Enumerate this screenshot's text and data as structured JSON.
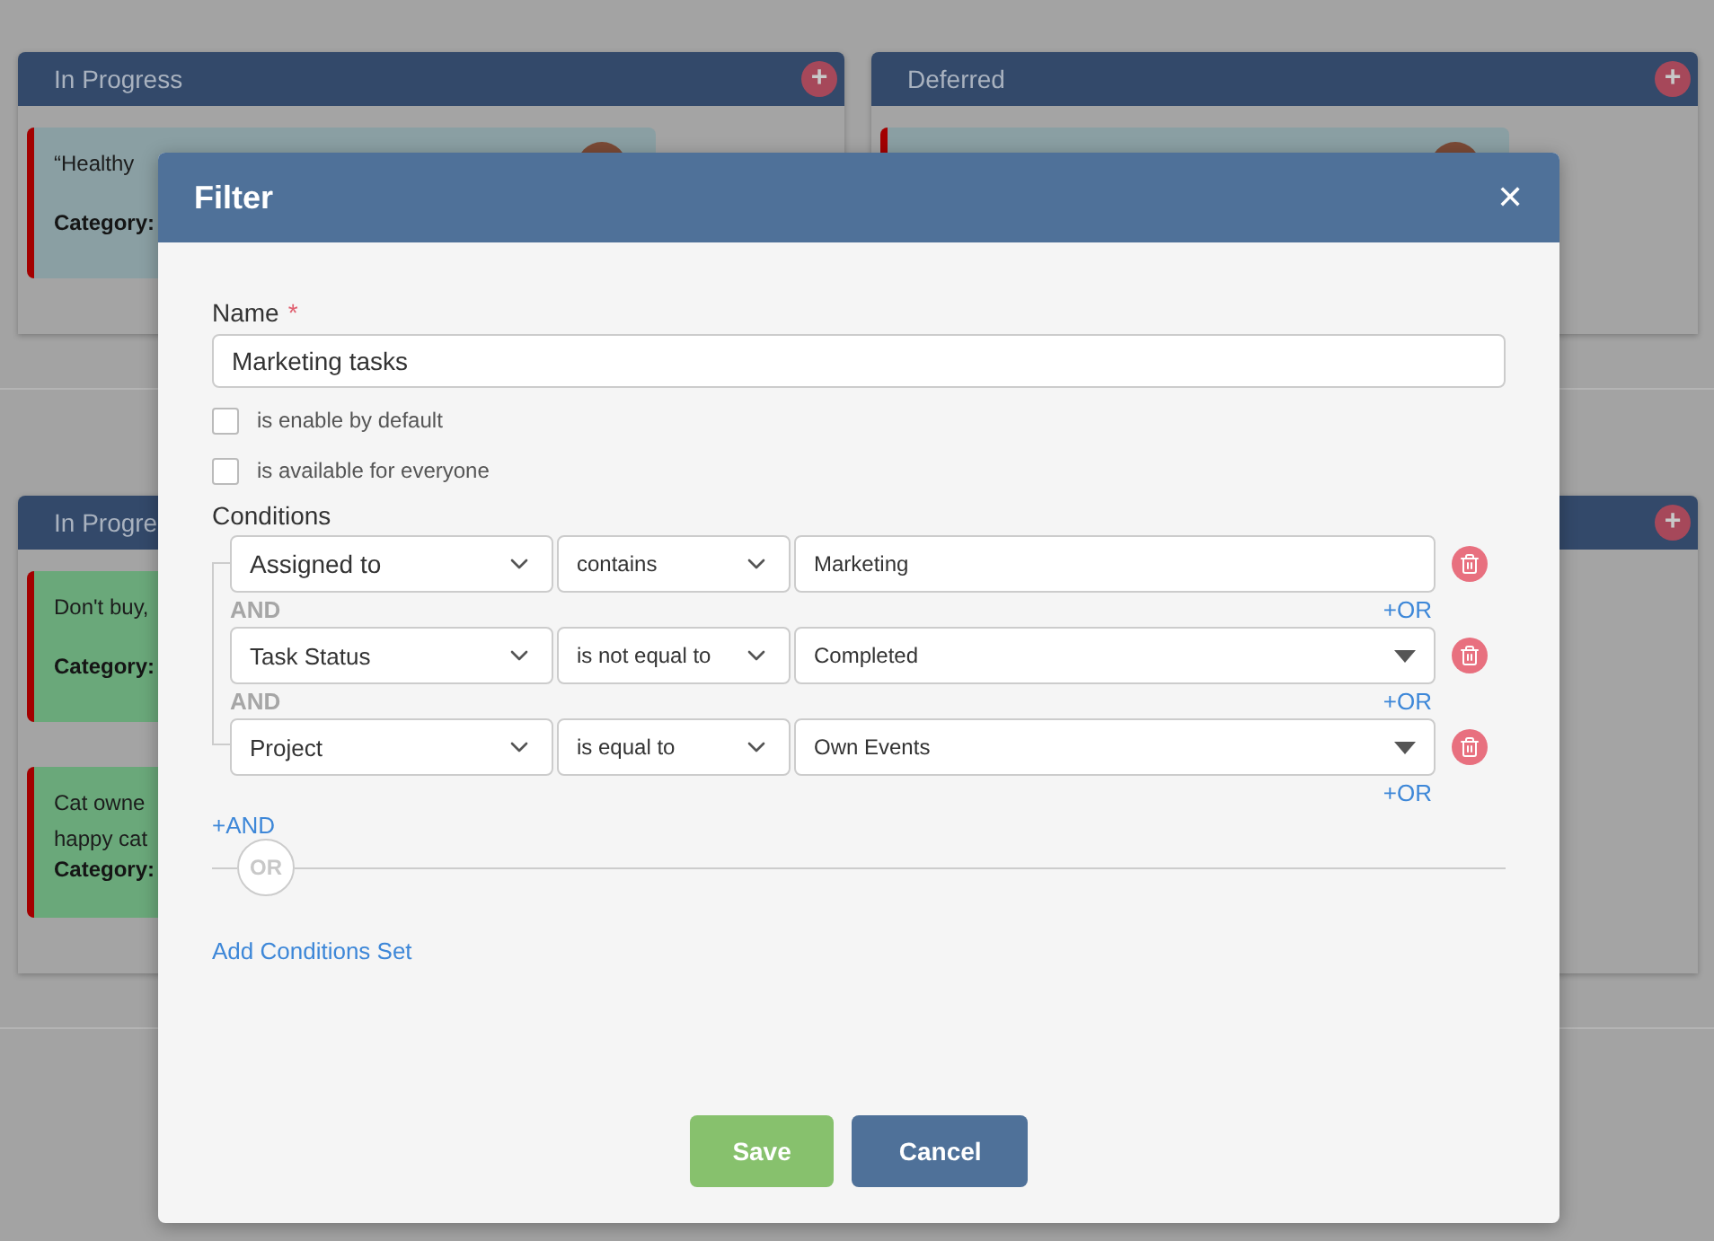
{
  "board": {
    "lanes": [
      {
        "columns": [
          {
            "title": "In Progress",
            "add_icon": "+",
            "cards": [
              {
                "lines": [
                  "“Healthy"
                ],
                "category_label": "Category:",
                "color": "#8a9fa3"
              }
            ]
          },
          {
            "title": "Deferred",
            "add_icon": "+",
            "cards": [
              {
                "color": "#8a9fa3"
              }
            ]
          }
        ]
      },
      {
        "columns": [
          {
            "title": "In Progre",
            "cards": [
              {
                "lines": [
                  "Don't buy,"
                ],
                "category_label": "Category:",
                "color": "#6aa87a"
              },
              {
                "lines": [
                  "Cat owne",
                  "happy cat"
                ],
                "category_label": "Category:",
                "color": "#6aa87a"
              }
            ]
          },
          {
            "add_icon": "+"
          }
        ]
      }
    ]
  },
  "dialog": {
    "title": "Filter",
    "close": "✕",
    "name_label": "Name",
    "required_mark": "*",
    "name_value": "Marketing tasks",
    "options": [
      {
        "label": "is enable by default",
        "checked": false
      },
      {
        "label": "is available for everyone",
        "checked": false
      }
    ],
    "conditions_label": "Conditions",
    "conditions": [
      {
        "field": "Assigned to",
        "operator": "contains",
        "value": "Marketing",
        "kind": "text",
        "or_link": "+OR"
      },
      {
        "connector": "AND",
        "field": "Task Status",
        "operator": "is not equal to",
        "value": "Completed",
        "kind": "dropdown",
        "or_link": "+OR"
      },
      {
        "connector": "AND",
        "field": "Project",
        "operator": "is equal to",
        "value": "Own Events",
        "kind": "dropdown",
        "or_link": "+OR"
      }
    ],
    "add_and": "+AND",
    "or_divider": "OR",
    "add_set": "Add Conditions Set",
    "buttons": [
      {
        "label": "Save",
        "kind": "primary"
      },
      {
        "label": "Cancel",
        "kind": "secondary"
      }
    ]
  }
}
